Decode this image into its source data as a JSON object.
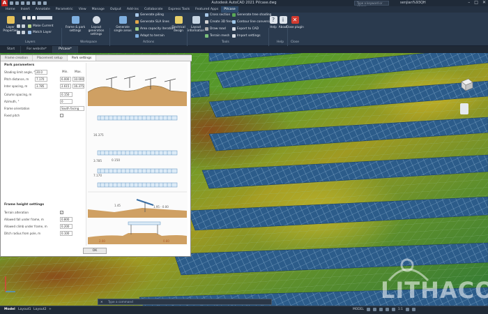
{
  "titlebar": {
    "logo": "A",
    "title": "Autodesk AutoCAD 2021   PVcase.dwg",
    "search_placeholder": "Type a keyword or phrase",
    "user": "senjian%93QH",
    "minimize": "–",
    "maximize": "□",
    "close": "✕"
  },
  "ribbon_tabs": [
    "Home",
    "Insert",
    "Annotate",
    "Parametric",
    "View",
    "Manage",
    "Output",
    "Add-ins",
    "Collaborate",
    "Express Tools",
    "Featured Apps",
    "PVcase"
  ],
  "active_ribbon_tab": "PVcase",
  "ribbon": {
    "layers": {
      "layer_properties": "Layer Properties",
      "make_current": "Make Current",
      "match_layer": "Match Layer",
      "panel": "Layers"
    },
    "workspace": {
      "frame_park_settings": "Frame & park settings",
      "layout_generation_settings": "Layout generation settings",
      "panel": "Workspace"
    },
    "actions": {
      "generate_single_areas": "Generate single areas",
      "generate_piling": "Generate piling",
      "generate_sld_lines": "Generate SLA lines",
      "area_capacity_iteration": "Area capacity iteration",
      "adapt_to_terrain": "Adapt to terrain",
      "electrical_design": "Electrical design",
      "panel": "Actions"
    },
    "tools": {
      "layout_information": "Layout information",
      "cross_section": "Cross section",
      "create_3d_fence": "Create 3D fence",
      "draw_road": "Draw road",
      "terrain_mesh": "Terrain mesh",
      "generate_tree_shading": "Generate tree shading",
      "contour_line_conversion": "Contour line conversion",
      "export_to_cad": "Export to CAD",
      "import_settings": "Import settings",
      "panel": "Tools"
    },
    "help": {
      "help": "Help",
      "about": "About",
      "panel": "Help"
    },
    "close": {
      "close_plugin": "Close plugin",
      "panel": "Close"
    }
  },
  "doc_tabs": [
    "Start",
    "For website*",
    "PVcase*"
  ],
  "active_doc_tab": "PVcase*",
  "dialog": {
    "tabs": [
      "Frame creation",
      "Placement setup",
      "Park settings"
    ],
    "active_tab": "Park settings",
    "park_params": {
      "title": "Park parameters",
      "col_min": "Min.",
      "col_max": "Max.",
      "rows": [
        {
          "label": "Shading limit angle, °",
          "value": "20.0",
          "min": "",
          "max": ""
        },
        {
          "label": "Pitch distance, m",
          "value": "7.170",
          "min": "6.000",
          "max": "10.000"
        },
        {
          "label": "Inter spacing, m",
          "value": "3.785",
          "min": "2.615",
          "max": "16.375"
        },
        {
          "label": "Column spacing, m",
          "value": "0.150",
          "min": "",
          "max": ""
        },
        {
          "label": "Azimuth, °",
          "value": "0",
          "min": "",
          "max": ""
        },
        {
          "label": "Frame orientation",
          "value": "South facing",
          "min": "",
          "max": ""
        },
        {
          "label": "Fixed pitch",
          "value": "",
          "min": "",
          "max": ""
        }
      ]
    },
    "frame_height": {
      "title": "Frame height settings",
      "rows": [
        {
          "label": "Terrain alteration",
          "value": "✓"
        },
        {
          "label": "Allowed fall under frame, m",
          "value": "0.800"
        },
        {
          "label": "Allowed climb under frame, m",
          "value": "0.200"
        },
        {
          "label": "Ditch radius from pole, m",
          "value": "0.100"
        }
      ]
    },
    "diagram_labels": {
      "dim_a": "16.375",
      "dim_b": "3.785",
      "dim_c": "0.150",
      "dim_d": "7.170",
      "height_top": "1.45",
      "height_right": "1.95 - 0.00",
      "ditch_left": "2.00",
      "ditch_right": "0.80"
    },
    "ok": "OK"
  },
  "status": {
    "layout_tabs": [
      "Model",
      "Layout1",
      "Layout2"
    ],
    "active_layout": "Model",
    "add_tab": "+",
    "command_placeholder": "Type a command",
    "command_close": "✕",
    "mode": "MODEL",
    "scale": "1:1"
  },
  "watermark": "LITHACO",
  "colors": {
    "accent": "#2f4b6b",
    "autocad_red": "#c6231f",
    "panel_blue": "#2c5c8a",
    "terrain_green": "#4a8c2a",
    "terrain_yellow": "#a4a022",
    "terrain_brown": "#7a4a1c"
  }
}
